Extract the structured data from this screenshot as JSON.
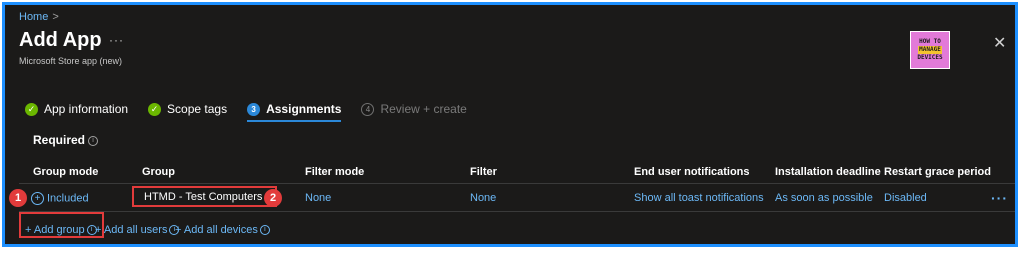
{
  "breadcrumb": {
    "home": "Home",
    "separator": ">"
  },
  "header": {
    "title": "Add App",
    "more": "···",
    "subtitle": "Microsoft Store app (new)",
    "logo_lines": [
      "HOW TO",
      "MANAGE",
      "DEVICES"
    ],
    "close": "✕"
  },
  "steps": [
    {
      "label": "App information",
      "state": "done",
      "icon": "✓"
    },
    {
      "label": "Scope tags",
      "state": "done",
      "icon": "✓"
    },
    {
      "label": "Assignments",
      "state": "current",
      "icon": "3"
    },
    {
      "label": "Review + create",
      "state": "todo",
      "icon": "4"
    }
  ],
  "section": {
    "label": "Required",
    "info": "i"
  },
  "table": {
    "headers": [
      "Group mode",
      "Group",
      "Filter mode",
      "Filter",
      "End user notifications",
      "Installation deadline",
      "Restart grace period"
    ],
    "row": {
      "group_mode": "Included",
      "group_mode_icon": "+",
      "group": "HTMD - Test Computers",
      "filter_mode": "None",
      "filter": "None",
      "notifications": "Show all toast notifications",
      "deadline": "As soon as possible",
      "grace_period": "Disabled",
      "more": "···"
    }
  },
  "actions": {
    "add_group": "+ Add group",
    "add_all_users": "+ Add all users",
    "add_all_devices": "+ Add all devices",
    "info": "i"
  },
  "annotations": {
    "badge1": "1",
    "badge2": "2"
  },
  "colors": {
    "accent": "#2b88d8",
    "link": "#6cb8f6",
    "success": "#6bb700",
    "callout": "#e23b3b",
    "frame": "#1e90ff"
  }
}
